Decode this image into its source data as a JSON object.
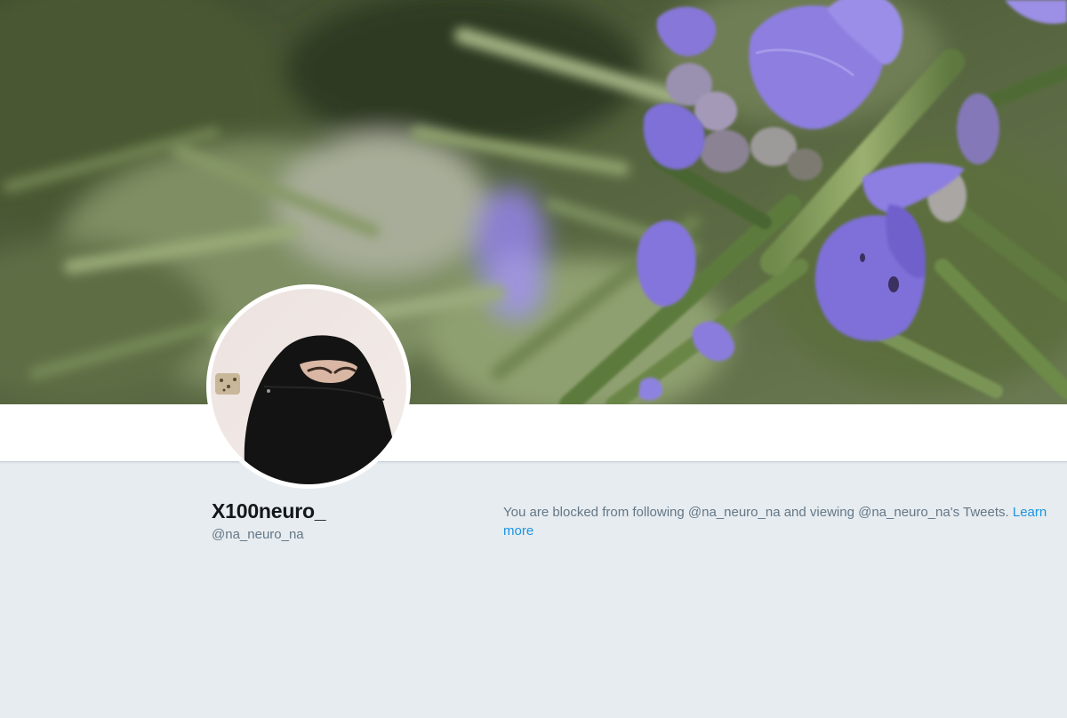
{
  "header": {
    "banner_image": "rosemary-flowers-photo"
  },
  "profile": {
    "avatar_image": "profile-photo",
    "display_name": "X100neuro_",
    "handle": "@na_neuro_na"
  },
  "blocked_notice": {
    "message": "You are blocked from following @na_neuro_na and viewing @na_neuro_na's Tweets.",
    "link_label": "Learn more"
  },
  "colors": {
    "page_background": "#e6ecf0",
    "name_text": "#14171a",
    "secondary_text": "#657786",
    "link": "#1b95e0"
  }
}
